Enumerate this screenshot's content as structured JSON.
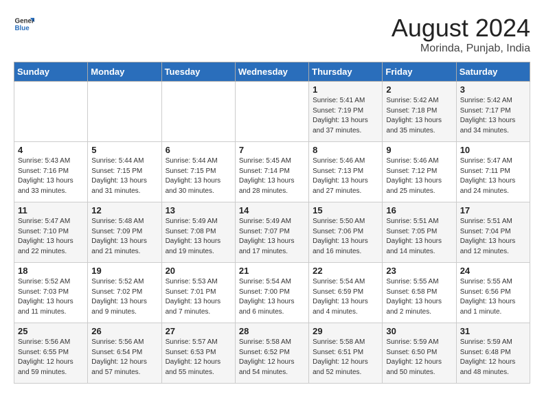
{
  "header": {
    "logo_general": "General",
    "logo_blue": "Blue",
    "month_year": "August 2024",
    "location": "Morinda, Punjab, India"
  },
  "weekdays": [
    "Sunday",
    "Monday",
    "Tuesday",
    "Wednesday",
    "Thursday",
    "Friday",
    "Saturday"
  ],
  "weeks": [
    [
      {
        "day": "",
        "content": ""
      },
      {
        "day": "",
        "content": ""
      },
      {
        "day": "",
        "content": ""
      },
      {
        "day": "",
        "content": ""
      },
      {
        "day": "1",
        "content": "Sunrise: 5:41 AM\nSunset: 7:19 PM\nDaylight: 13 hours\nand 37 minutes."
      },
      {
        "day": "2",
        "content": "Sunrise: 5:42 AM\nSunset: 7:18 PM\nDaylight: 13 hours\nand 35 minutes."
      },
      {
        "day": "3",
        "content": "Sunrise: 5:42 AM\nSunset: 7:17 PM\nDaylight: 13 hours\nand 34 minutes."
      }
    ],
    [
      {
        "day": "4",
        "content": "Sunrise: 5:43 AM\nSunset: 7:16 PM\nDaylight: 13 hours\nand 33 minutes."
      },
      {
        "day": "5",
        "content": "Sunrise: 5:44 AM\nSunset: 7:15 PM\nDaylight: 13 hours\nand 31 minutes."
      },
      {
        "day": "6",
        "content": "Sunrise: 5:44 AM\nSunset: 7:15 PM\nDaylight: 13 hours\nand 30 minutes."
      },
      {
        "day": "7",
        "content": "Sunrise: 5:45 AM\nSunset: 7:14 PM\nDaylight: 13 hours\nand 28 minutes."
      },
      {
        "day": "8",
        "content": "Sunrise: 5:46 AM\nSunset: 7:13 PM\nDaylight: 13 hours\nand 27 minutes."
      },
      {
        "day": "9",
        "content": "Sunrise: 5:46 AM\nSunset: 7:12 PM\nDaylight: 13 hours\nand 25 minutes."
      },
      {
        "day": "10",
        "content": "Sunrise: 5:47 AM\nSunset: 7:11 PM\nDaylight: 13 hours\nand 24 minutes."
      }
    ],
    [
      {
        "day": "11",
        "content": "Sunrise: 5:47 AM\nSunset: 7:10 PM\nDaylight: 13 hours\nand 22 minutes."
      },
      {
        "day": "12",
        "content": "Sunrise: 5:48 AM\nSunset: 7:09 PM\nDaylight: 13 hours\nand 21 minutes."
      },
      {
        "day": "13",
        "content": "Sunrise: 5:49 AM\nSunset: 7:08 PM\nDaylight: 13 hours\nand 19 minutes."
      },
      {
        "day": "14",
        "content": "Sunrise: 5:49 AM\nSunset: 7:07 PM\nDaylight: 13 hours\nand 17 minutes."
      },
      {
        "day": "15",
        "content": "Sunrise: 5:50 AM\nSunset: 7:06 PM\nDaylight: 13 hours\nand 16 minutes."
      },
      {
        "day": "16",
        "content": "Sunrise: 5:51 AM\nSunset: 7:05 PM\nDaylight: 13 hours\nand 14 minutes."
      },
      {
        "day": "17",
        "content": "Sunrise: 5:51 AM\nSunset: 7:04 PM\nDaylight: 13 hours\nand 12 minutes."
      }
    ],
    [
      {
        "day": "18",
        "content": "Sunrise: 5:52 AM\nSunset: 7:03 PM\nDaylight: 13 hours\nand 11 minutes."
      },
      {
        "day": "19",
        "content": "Sunrise: 5:52 AM\nSunset: 7:02 PM\nDaylight: 13 hours\nand 9 minutes."
      },
      {
        "day": "20",
        "content": "Sunrise: 5:53 AM\nSunset: 7:01 PM\nDaylight: 13 hours\nand 7 minutes."
      },
      {
        "day": "21",
        "content": "Sunrise: 5:54 AM\nSunset: 7:00 PM\nDaylight: 13 hours\nand 6 minutes."
      },
      {
        "day": "22",
        "content": "Sunrise: 5:54 AM\nSunset: 6:59 PM\nDaylight: 13 hours\nand 4 minutes."
      },
      {
        "day": "23",
        "content": "Sunrise: 5:55 AM\nSunset: 6:58 PM\nDaylight: 13 hours\nand 2 minutes."
      },
      {
        "day": "24",
        "content": "Sunrise: 5:55 AM\nSunset: 6:56 PM\nDaylight: 13 hours\nand 1 minute."
      }
    ],
    [
      {
        "day": "25",
        "content": "Sunrise: 5:56 AM\nSunset: 6:55 PM\nDaylight: 12 hours\nand 59 minutes."
      },
      {
        "day": "26",
        "content": "Sunrise: 5:56 AM\nSunset: 6:54 PM\nDaylight: 12 hours\nand 57 minutes."
      },
      {
        "day": "27",
        "content": "Sunrise: 5:57 AM\nSunset: 6:53 PM\nDaylight: 12 hours\nand 55 minutes."
      },
      {
        "day": "28",
        "content": "Sunrise: 5:58 AM\nSunset: 6:52 PM\nDaylight: 12 hours\nand 54 minutes."
      },
      {
        "day": "29",
        "content": "Sunrise: 5:58 AM\nSunset: 6:51 PM\nDaylight: 12 hours\nand 52 minutes."
      },
      {
        "day": "30",
        "content": "Sunrise: 5:59 AM\nSunset: 6:50 PM\nDaylight: 12 hours\nand 50 minutes."
      },
      {
        "day": "31",
        "content": "Sunrise: 5:59 AM\nSunset: 6:48 PM\nDaylight: 12 hours\nand 48 minutes."
      }
    ]
  ]
}
